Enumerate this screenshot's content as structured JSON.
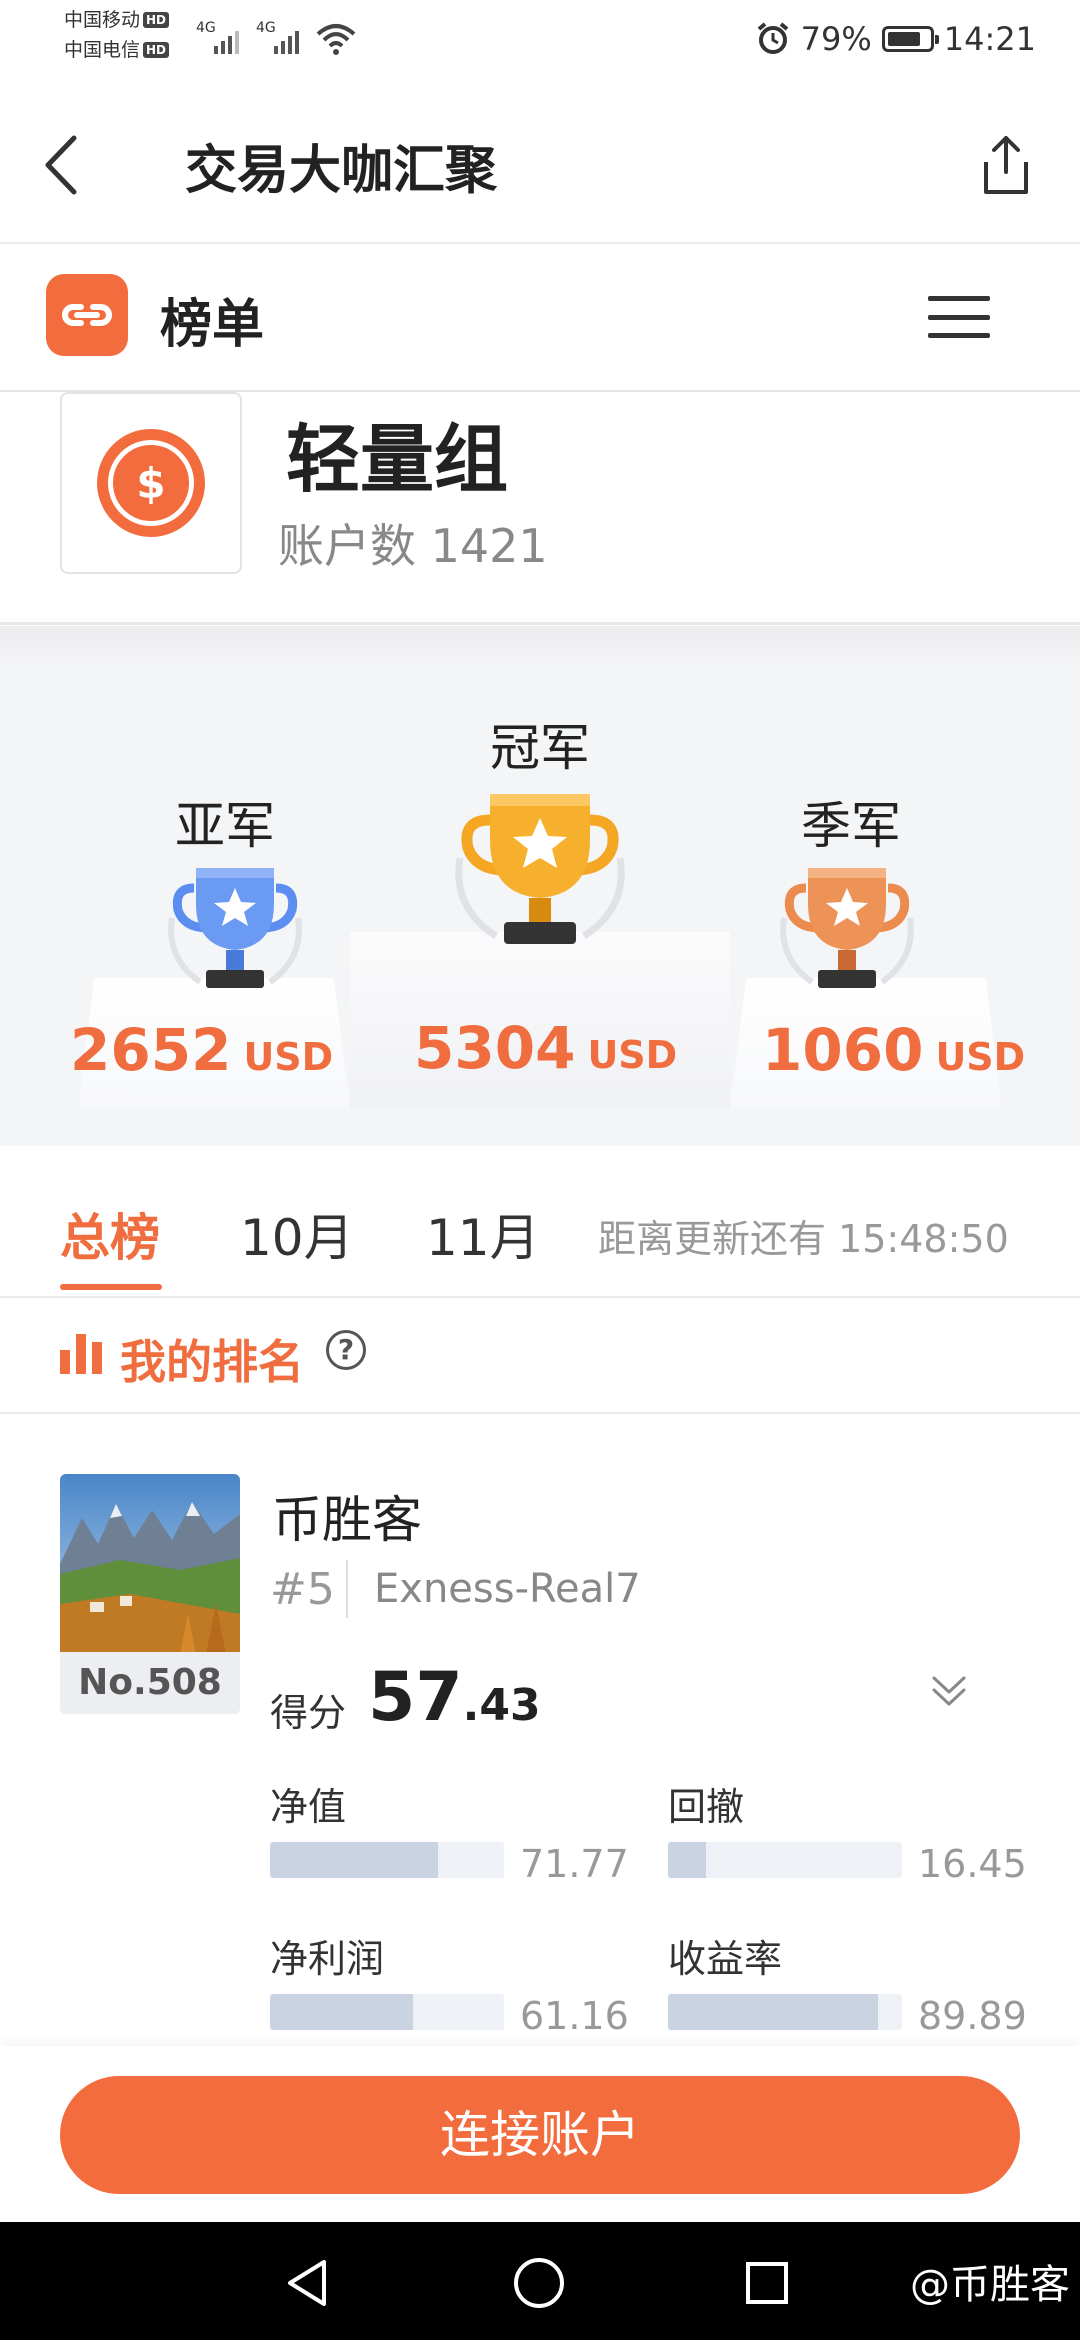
{
  "status_bar": {
    "carrier1": "中国移动",
    "carrier2": "中国电信",
    "hd": "HD",
    "net1": "4G",
    "net2": "4G",
    "battery": "79%",
    "battery_level": 0.79,
    "time": "14:21"
  },
  "header": {
    "title": "交易大咖汇聚"
  },
  "brand": {
    "title": "榜单",
    "accent": "#f36c3d"
  },
  "group": {
    "name": "轻量组",
    "account_count": "账户数 1421",
    "icon_symbol": "$"
  },
  "podium": {
    "second": {
      "label": "亚军",
      "amount": "2652",
      "unit": "USD",
      "trophy_color": "#5b8ef0"
    },
    "first": {
      "label": "冠军",
      "amount": "5304",
      "unit": "USD",
      "trophy_color": "#f5a623"
    },
    "third": {
      "label": "季军",
      "amount": "1060",
      "unit": "USD",
      "trophy_color": "#ec8b4e"
    }
  },
  "tabs": [
    {
      "label": "总榜",
      "active": true
    },
    {
      "label": "10月",
      "active": false
    },
    {
      "label": "11月",
      "active": false
    }
  ],
  "countdown": "距离更新还有 15:48:50",
  "my_rank": {
    "title": "我的排名",
    "help_symbol": "?"
  },
  "card": {
    "avatar_rank": "No.508",
    "user_name": "币胜客",
    "rank_position": "#5",
    "server": "Exness-Real7",
    "score_label": "得分",
    "score_int": "57",
    "score_dec": ".43",
    "metrics": [
      {
        "label": "净值",
        "value": "71.77",
        "fraction": 0.7177
      },
      {
        "label": "回撤",
        "value": "16.45",
        "fraction": 0.1645
      },
      {
        "label": "净利润",
        "value": "61.16",
        "fraction": 0.6116
      },
      {
        "label": "收益率",
        "value": "89.89",
        "fraction": 0.8989
      }
    ]
  },
  "bottom": {
    "connect_label": "连接账户"
  },
  "watermark": "@币胜客"
}
